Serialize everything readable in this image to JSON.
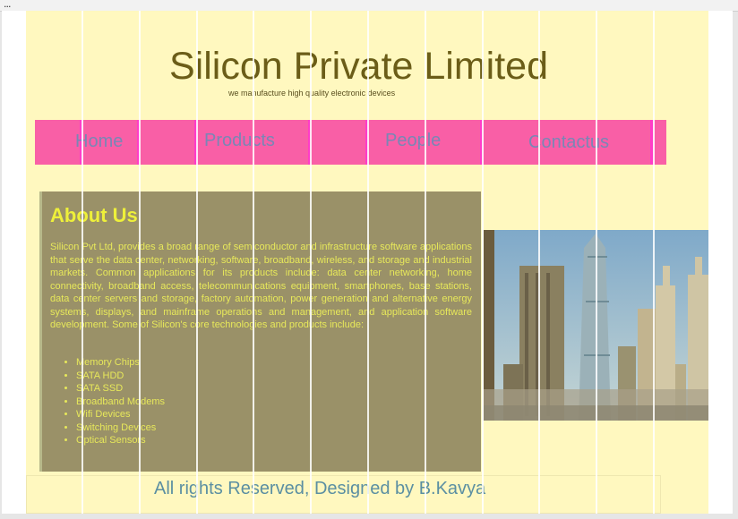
{
  "browser": {
    "menu_glyph": "..."
  },
  "header": {
    "title": "Silicon Private Limited",
    "tagline": "we manufacture high quality electronic devices"
  },
  "nav": {
    "items": [
      {
        "label": "Home"
      },
      {
        "label": "Products"
      },
      {
        "label": "People"
      },
      {
        "label": "Contactus"
      }
    ]
  },
  "about": {
    "heading": "About Us",
    "paragraph": "Silicon Pvt Ltd, provides a broad range of semiconductor and infrastructure software applications that serve the data center, networking, software, broadband, wireless, and storage and industrial markets. Common applications for its products include: data center networking, home connectivity, broadband access, telecommunications equipment, smartphones, base stations, data center servers and storage, factory automation, power generation and alternative energy systems, displays, and mainframe operations and management, and application software development. Some of Silicon's core technologies and products include:",
    "products": [
      "Memory Chips",
      "SATA HDD",
      "SATA SSD",
      "Broadband Modems",
      "Wifi Devices",
      "Switching Devices",
      "Optical Sensors"
    ]
  },
  "image": {
    "subject": "city-skyline-image"
  },
  "footer": {
    "text": "All rights Reserved, Designed by B.Kavya"
  },
  "colors": {
    "page_background": "#fff8bf",
    "nav_background": "#f95fa6",
    "nav_text": "#7a86b5",
    "title_text": "#6b5d18",
    "about_background": "#9a9168",
    "about_heading": "#eef03a",
    "about_text": "#e7e85a",
    "footer_text": "#5b8fa2"
  }
}
